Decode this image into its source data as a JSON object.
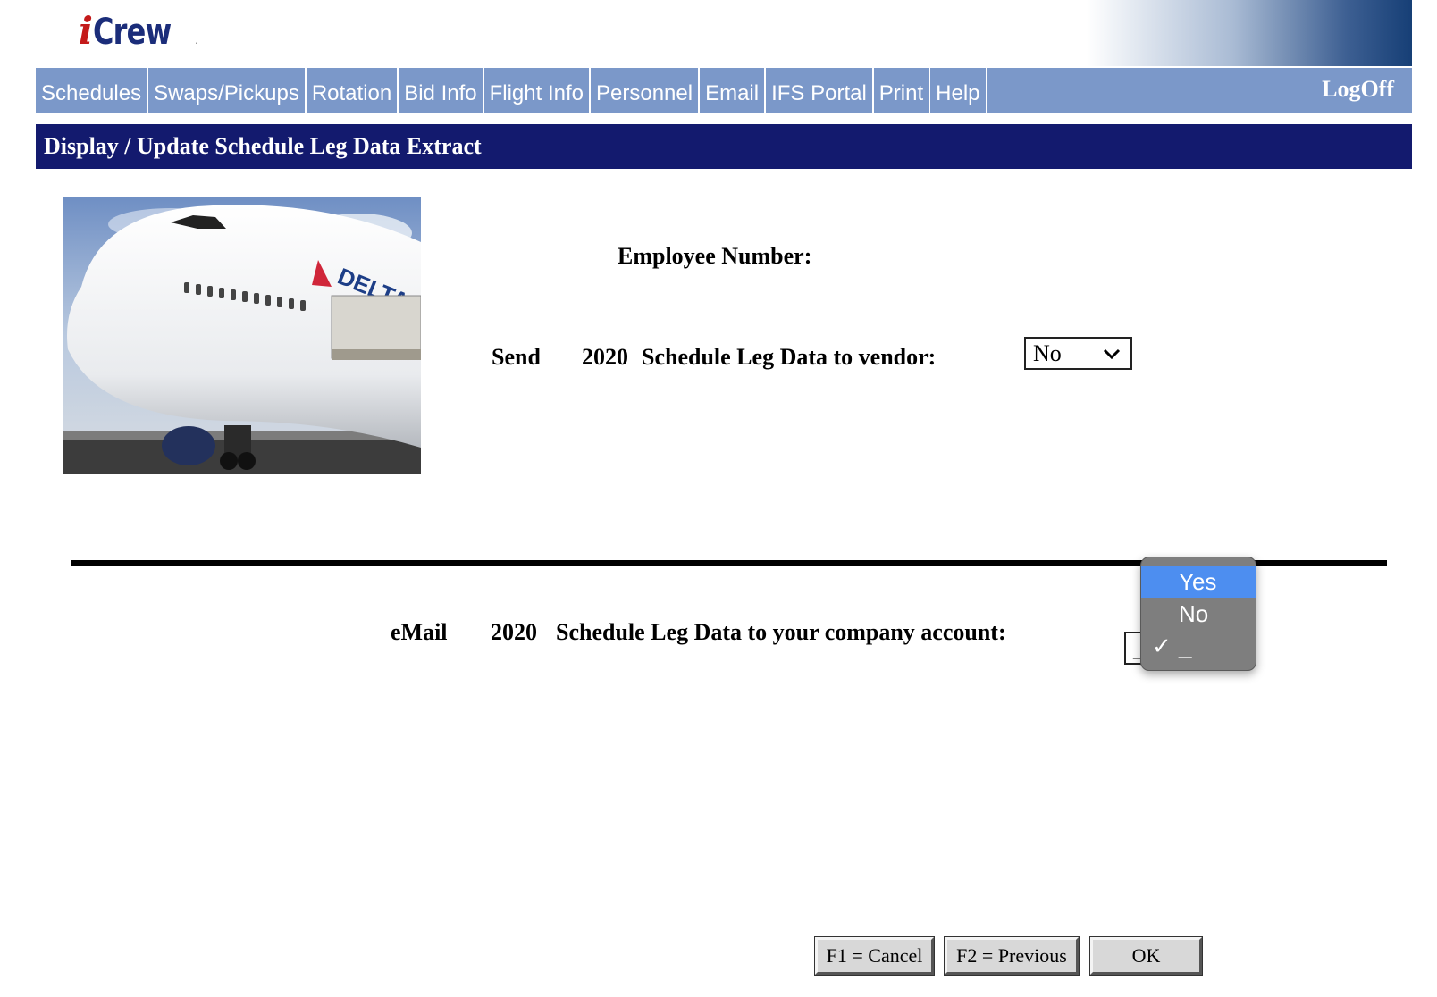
{
  "header": {
    "logo_i": "i",
    "logo_word": "Crew",
    "logo_dot": "."
  },
  "nav": {
    "items": [
      {
        "label": "Schedules"
      },
      {
        "label": "Swaps/Pickups"
      },
      {
        "label": "Rotation"
      },
      {
        "label": "Bid Info"
      },
      {
        "label": "Flight Info"
      },
      {
        "label": "Personnel"
      },
      {
        "label": "Email"
      },
      {
        "label": "IFS Portal"
      },
      {
        "label": "Print"
      },
      {
        "label": "Help"
      }
    ],
    "logoff": "LogOff"
  },
  "page_title": "Display / Update Schedule Leg Data Extract",
  "form": {
    "employee_label": "Employee Number:",
    "employee_value": "",
    "vendor_row": {
      "verb": "Send",
      "year": "2020",
      "text": "Schedule Leg Data to vendor:",
      "selected": "No"
    },
    "email_row": {
      "verb": "eMail",
      "year": "2020",
      "text": "Schedule Leg Data to your company account:",
      "selected": "_"
    }
  },
  "dropdown": {
    "options": [
      "Yes",
      "No",
      "_"
    ],
    "highlighted": "Yes",
    "checked": "_",
    "check_glyph": "✓"
  },
  "buttons": {
    "cancel": "F1 = Cancel",
    "previous": "F2 = Previous",
    "ok": "OK"
  },
  "colors": {
    "nav_bg": "#7b98c9",
    "title_bg": "#131a6e",
    "dropdown_bg": "#7e7e7e",
    "dropdown_highlight": "#4d8ef0",
    "logo_i": "#c41a1a",
    "logo_word": "#1b2d7a"
  }
}
